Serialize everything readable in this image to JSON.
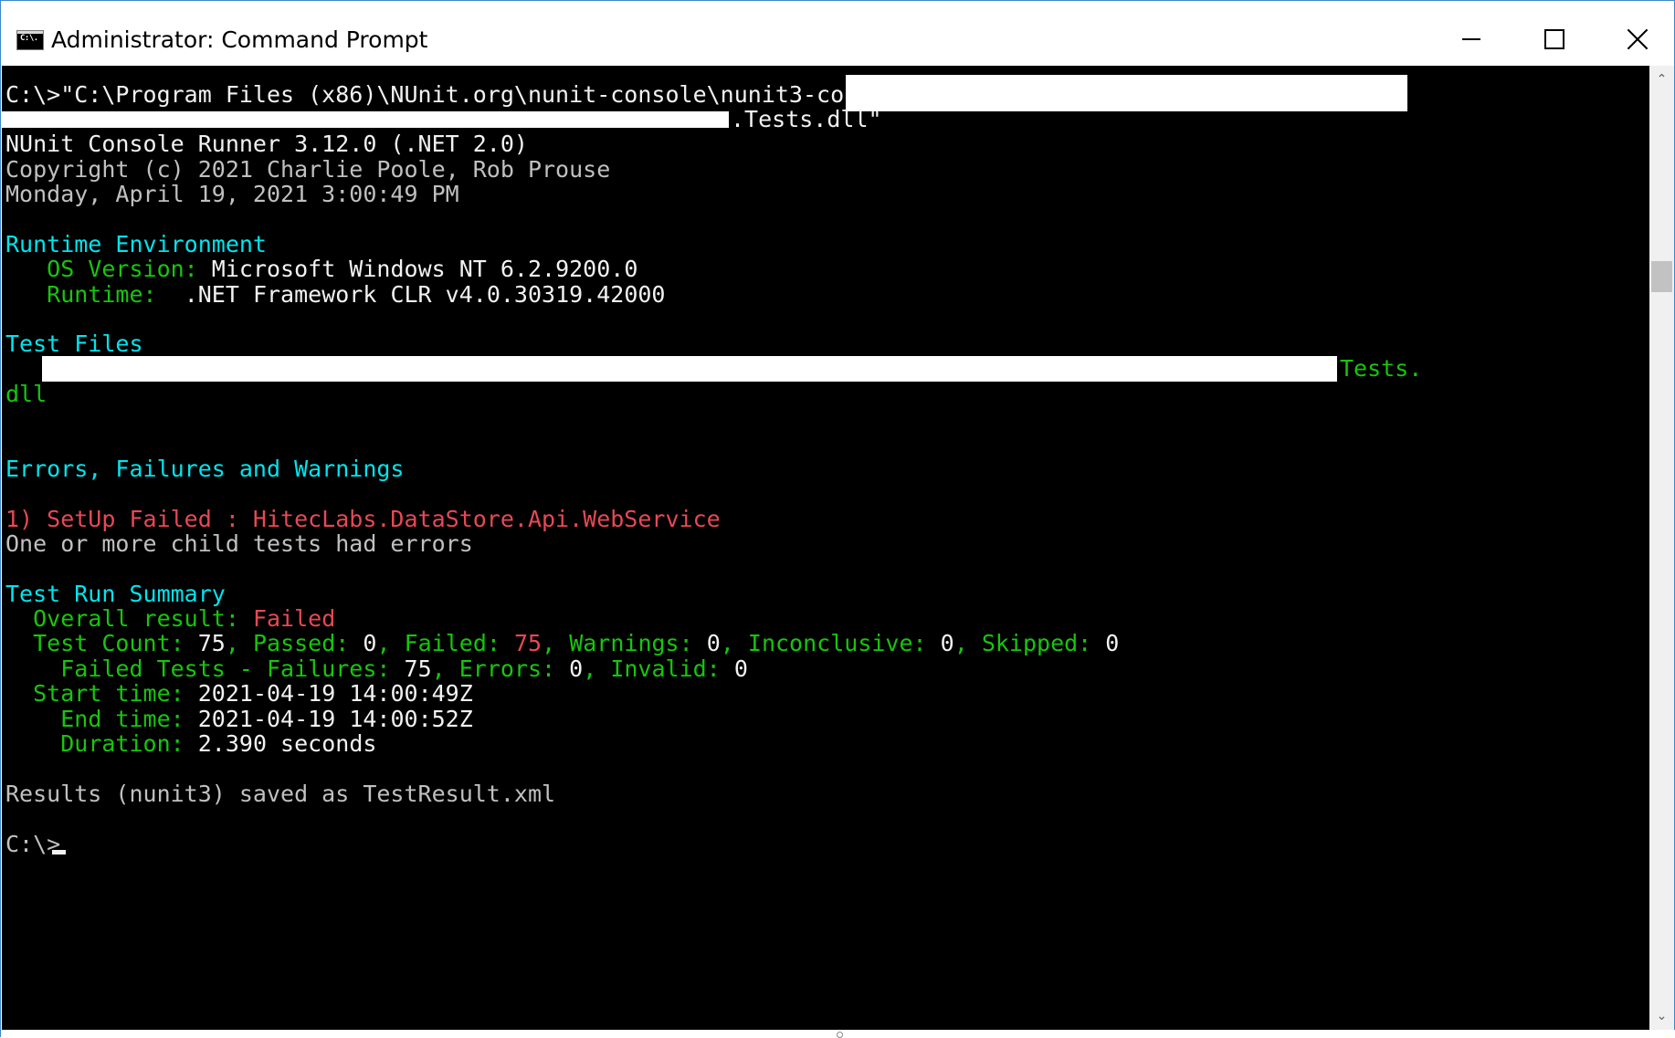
{
  "window": {
    "title": "Administrator: Command Prompt",
    "icon_label": "C:\\."
  },
  "colors": {
    "console_bg": "#000000",
    "text_white": "#f2f2f2",
    "text_gray": "#c0c0c0",
    "text_cyan": "#00e5ee",
    "text_green": "#16c60c",
    "text_red": "#e74856"
  },
  "console": {
    "cmd_line": "C:\\>\"C:\\Program Files (x86)\\NUnit.org\\nunit-console\\nunit3-console.exe\"",
    "cmd_line2_tail": ".Tests.dll\"",
    "runner": "NUnit Console Runner 3.12.0 (.NET 2.0)",
    "copyright": "Copyright (c) 2021 Charlie Poole, Rob Prouse",
    "date": "Monday, April 19, 2021 3:00:49 PM",
    "runtime_header": "Runtime Environment",
    "os_label": "OS Version:",
    "os_value": "Microsoft Windows NT 6.2.9200.0",
    "runtime_label": "Runtime:",
    "runtime_value": ".NET Framework CLR v4.0.30319.42000",
    "test_files_header": "Test Files",
    "test_file_tail": "Tests.",
    "test_file_wrap": "dll",
    "errors_header": "Errors, Failures and Warnings",
    "error_1": "1) SetUp Failed : HitecLabs.DataStore.Api.WebService",
    "error_1_detail": "One or more child tests had errors",
    "summary_header": "Test Run Summary",
    "overall_label": "Overall result:",
    "overall_value": "Failed",
    "test_count_label": "Test Count:",
    "test_count": "75",
    "passed_label": "Passed:",
    "passed": "0",
    "failed_label": "Failed:",
    "failed": "75",
    "warnings_label": "Warnings:",
    "warnings": "0",
    "inconclusive_label": "Inconclusive:",
    "inconclusive": "0",
    "skipped_label": "Skipped:",
    "skipped": "0",
    "failed_tests_label": "Failed Tests - Failures:",
    "failures": "75",
    "errors_label": "Errors:",
    "errors": "0",
    "invalid_label": "Invalid:",
    "invalid": "0",
    "start_label": "Start time:",
    "start_value": "2021-04-19 14:00:49Z",
    "end_label": "End time:",
    "end_value": "2021-04-19 14:00:52Z",
    "duration_label": "Duration:",
    "duration_value": "2.390 seconds",
    "results_saved": "Results (nunit3) saved as TestResult.xml",
    "prompt": "C:\\>"
  },
  "scrollbar": {
    "up_icon": "scroll-up-arrow-icon",
    "down_icon": "scroll-down-arrow-icon"
  }
}
